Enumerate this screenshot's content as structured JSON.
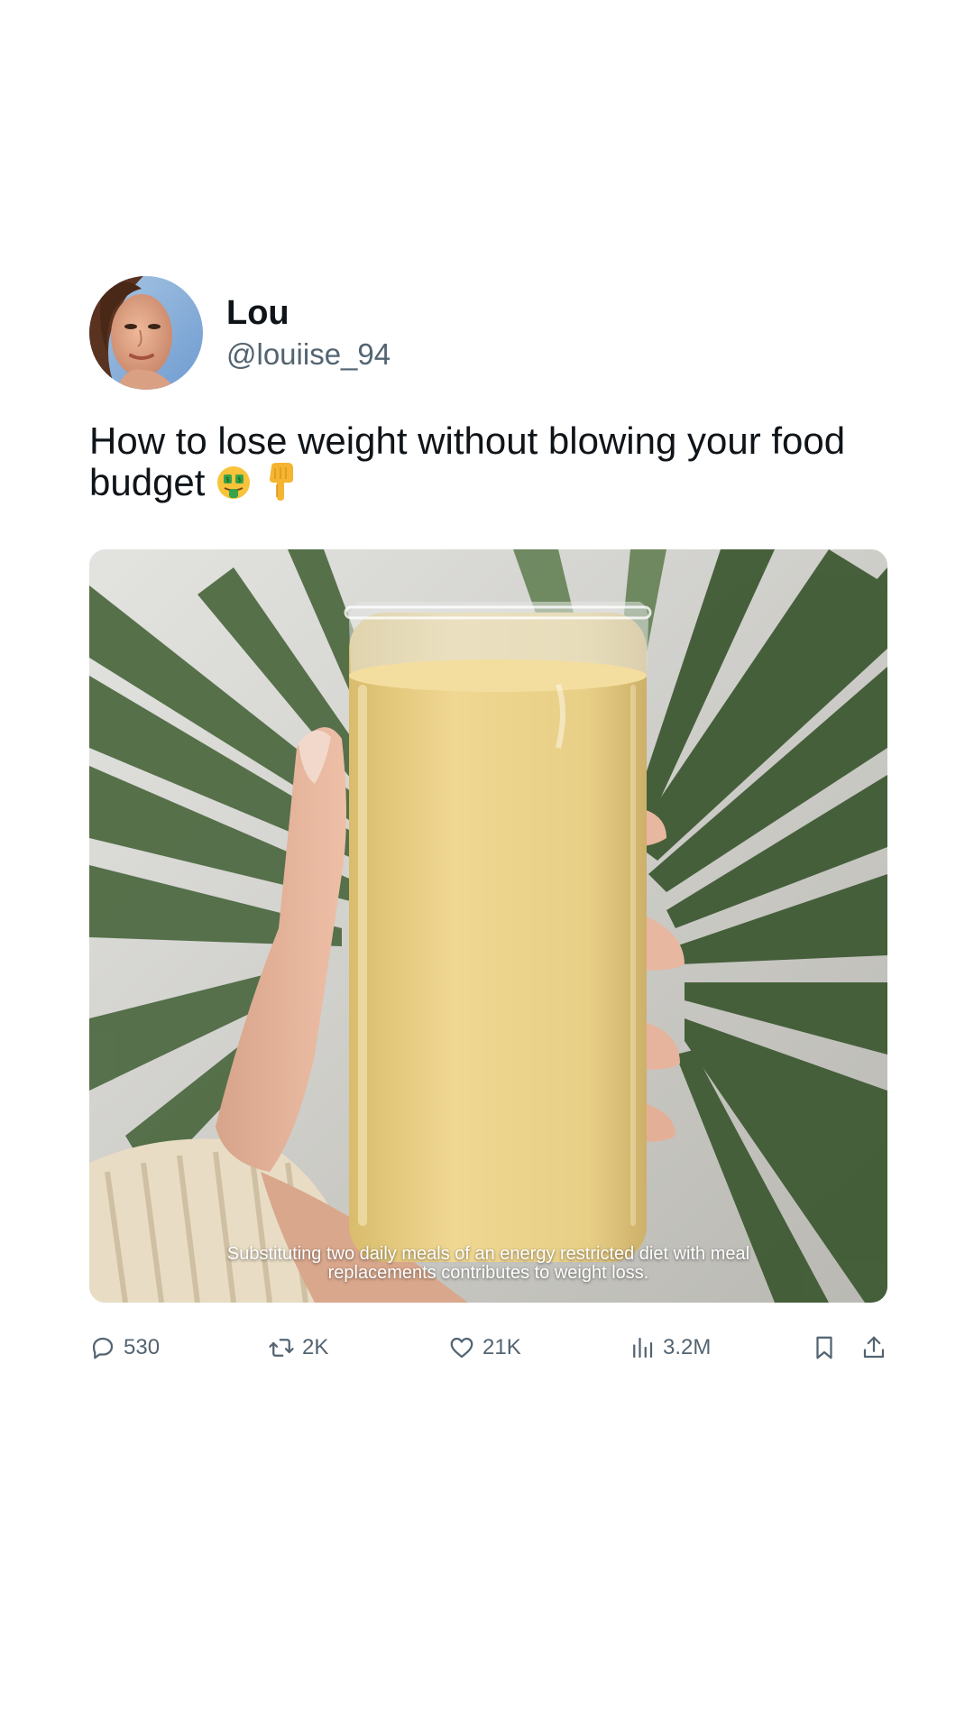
{
  "author": {
    "display_name": "Lou",
    "handle": "@louiise_94"
  },
  "post": {
    "text": "How to lose weight without blowing your food budget",
    "emojis": [
      "money-mouth-face",
      "backhand-index-pointing-down"
    ],
    "media_caption": "Substituting two daily meals of an energy restricted diet with meal replacements contributes to weight loss."
  },
  "actions": {
    "replies": "530",
    "reposts": "2K",
    "likes": "21K",
    "views": "3.2M"
  },
  "colors": {
    "text_primary": "#0f1419",
    "text_secondary": "#536471",
    "smoothie": "#ecd28a"
  }
}
